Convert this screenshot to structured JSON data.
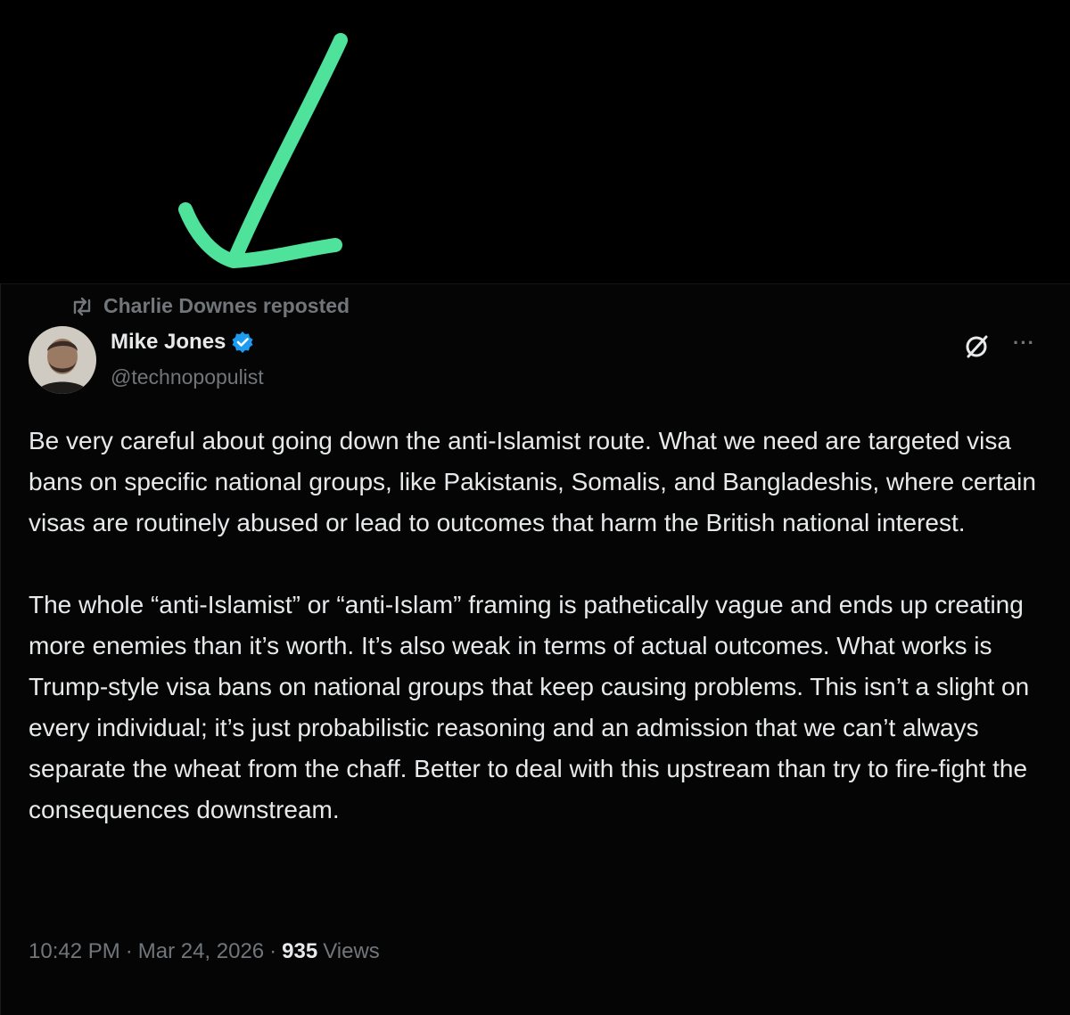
{
  "annotation": {
    "arrow_color": "#4ee29a"
  },
  "repost": {
    "icon": "repost-icon",
    "text": "Charlie Downes reposted"
  },
  "author": {
    "name": "Mike Jones",
    "handle": "@technopopulist",
    "verified": true,
    "verified_color": "#1d9bf0",
    "avatar_icon": "avatar"
  },
  "actions": {
    "grok_icon": "grok-icon",
    "more_icon": "more-icon",
    "more_label": "···"
  },
  "tweet": {
    "paragraphs": [
      "Be very careful about going down the anti-Islamist route. What we need are targeted visa bans on specific national groups, like Pakistanis, Somalis, and Bangladeshis, where certain visas are routinely abused or lead to outcomes that harm the British national interest.",
      "The whole “anti-Islamist” or “anti-Islam” framing is pathetically vague and ends up creating more enemies than it’s worth. It’s also weak in terms of actual outcomes. What works is Trump-style visa bans on national groups that keep causing problems. This isn’t a slight on every individual; it’s just probabilistic reasoning and an admission that we can’t always separate the wheat from the chaff. Better to deal with this upstream than try to fire-fight the consequences downstream."
    ]
  },
  "meta": {
    "time": "10:42 PM",
    "separator": "·",
    "date": "Mar 24, 2026",
    "views_count": "935",
    "views_label": "Views"
  }
}
